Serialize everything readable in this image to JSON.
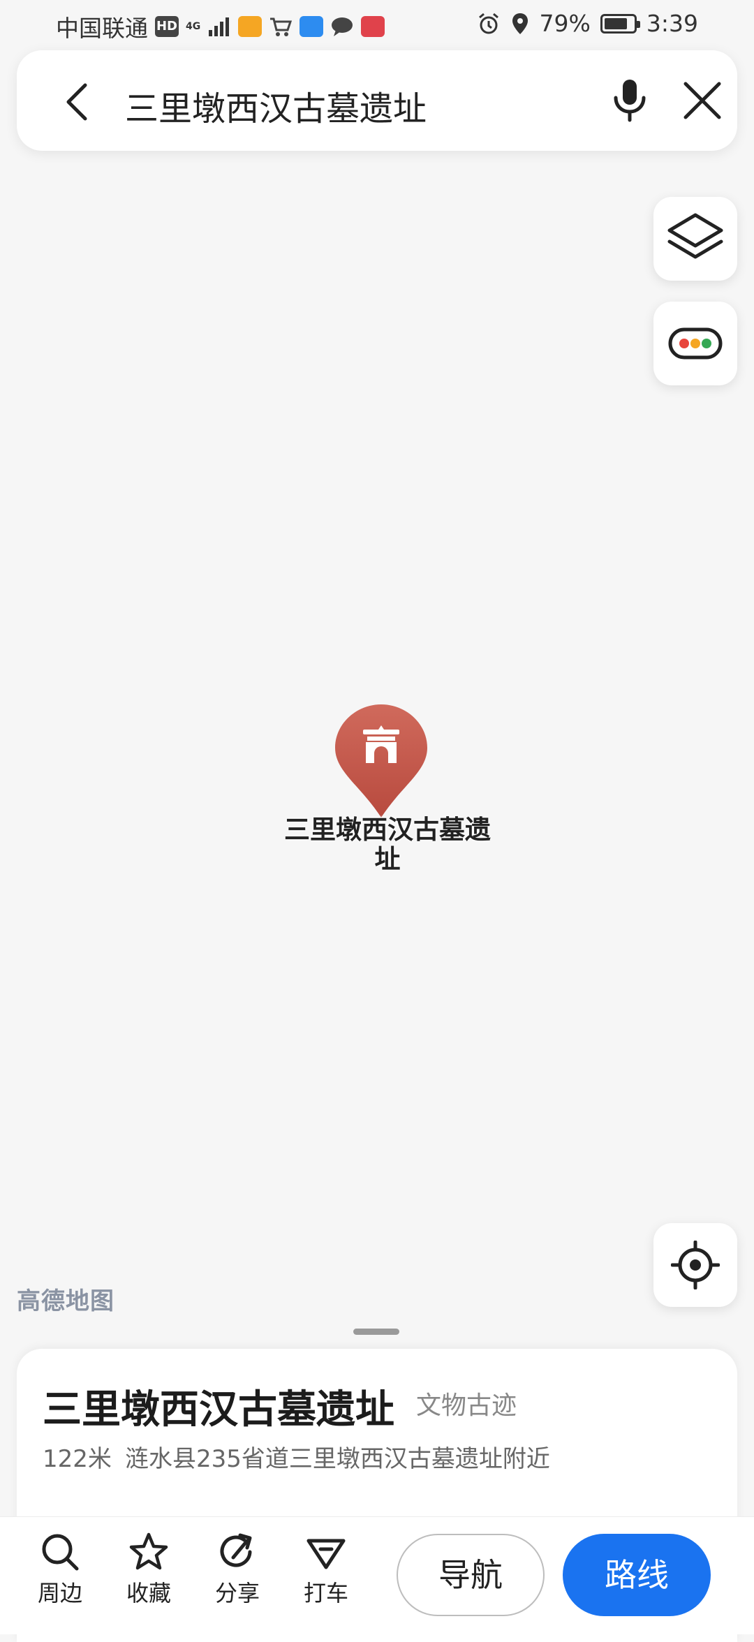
{
  "status_bar": {
    "carrier": "中国联通",
    "hd_badge": "HD",
    "network": "4G",
    "battery_percent": "79%",
    "battery_level": 0.79,
    "time": "3:39"
  },
  "search": {
    "query": "三里墩西汉古墓遗址"
  },
  "map": {
    "poi_label": "三里墩西汉古墓遗址",
    "watermark": "高德地图",
    "pin_color": "#c85a4e"
  },
  "poi_card": {
    "name": "三里墩西汉古墓遗址",
    "category": "文物古迹",
    "distance": "122米",
    "address": "涟水县235省道三里墩西汉古墓遗址附近"
  },
  "actions": {
    "nearby": "周边",
    "favorite": "收藏",
    "share": "分享",
    "taxi": "打车",
    "navigate": "导航",
    "route": "路线"
  },
  "colors": {
    "accent": "#1a73f0"
  }
}
